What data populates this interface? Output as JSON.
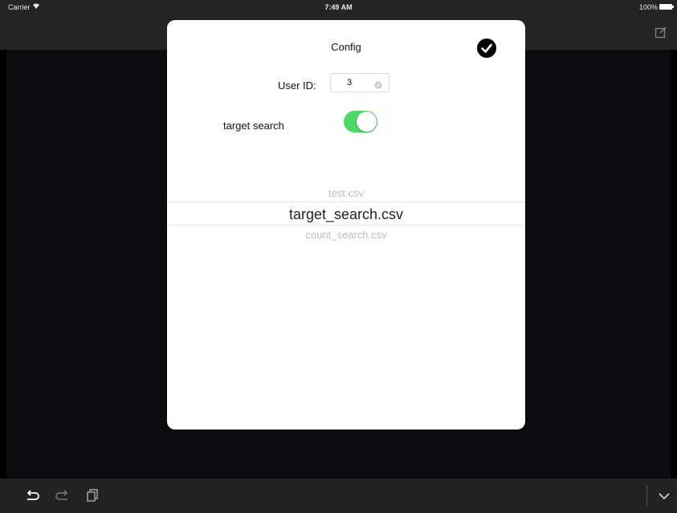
{
  "status_bar": {
    "carrier": "Carrier",
    "time": "7:49 AM",
    "battery": "100%"
  },
  "modal": {
    "title": "Config",
    "user_id_label": "User ID:",
    "user_id_value": "3",
    "target_search_label": "target search",
    "target_search_on": true,
    "picker": {
      "items": [
        "test.csv",
        "target_search.csv",
        "count_search.csv"
      ],
      "selected": "target_search.csv"
    }
  },
  "colors": {
    "toggle_on": "#4cd964",
    "background": "#000000",
    "bar": "#242424"
  },
  "icons": {
    "done": "checkmark-circle-icon",
    "compose": "compose-icon",
    "undo": "undo-icon",
    "redo": "redo-icon",
    "paste": "paste-icon",
    "collapse": "chevron-down-icon"
  }
}
